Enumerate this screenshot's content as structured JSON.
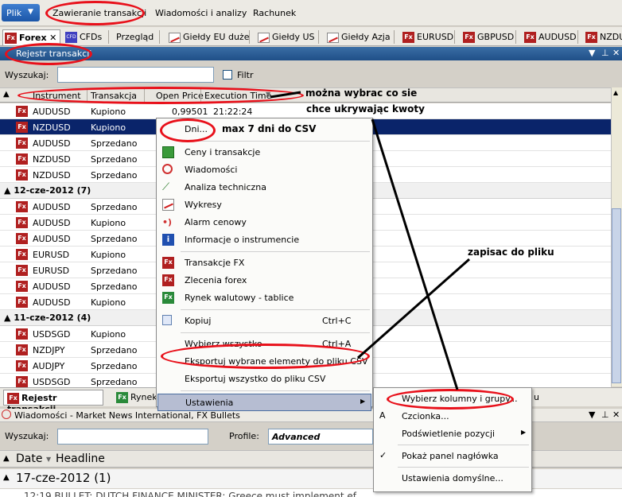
{
  "menubar": {
    "file_label": "Plik",
    "items": [
      "Zawieranie transakcji",
      "Wiadomości i analizy",
      "Rachunek"
    ]
  },
  "tabs": [
    {
      "label": "Forex",
      "icon": "fx-icon",
      "active": true
    },
    {
      "label": "CFDs",
      "icon": "cfd-icon"
    },
    {
      "label": "Przegląd"
    },
    {
      "label": "Giełdy EU duże",
      "icon": "chart-icon"
    },
    {
      "label": "Giełdy US",
      "icon": "chart-icon"
    },
    {
      "label": "Giełdy Azja",
      "icon": "chart-icon"
    },
    {
      "label": "EURUSD",
      "icon": "fx-icon"
    },
    {
      "label": "GBPUSD",
      "icon": "fx-icon"
    },
    {
      "label": "AUDUSD",
      "icon": "fx-icon"
    },
    {
      "label": "NZDU",
      "icon": "fx-icon"
    }
  ],
  "panel": {
    "title": "Rejestr transakcji",
    "search_label": "Wyszukaj:",
    "search_value": "",
    "filter_label": "Filtr"
  },
  "grid": {
    "columns": [
      "Instrument",
      "Transakcja",
      "Open Price",
      "Execution Time"
    ],
    "rows": [
      {
        "type": "row",
        "instrument": "AUDUSD",
        "transaction": "Kupiono",
        "price": "0,99501",
        "time": "21:22:24"
      },
      {
        "type": "row",
        "instrument": "NZDUSD",
        "transaction": "Kupiono",
        "price": "",
        "time": "",
        "selected": true
      },
      {
        "type": "row",
        "instrument": "AUDUSD",
        "transaction": "Sprzedano",
        "price": "",
        "time": ""
      },
      {
        "type": "row",
        "instrument": "NZDUSD",
        "transaction": "Sprzedano",
        "price": "",
        "time": ""
      },
      {
        "type": "row",
        "instrument": "NZDUSD",
        "transaction": "Sprzedano",
        "price": "",
        "time": ""
      },
      {
        "type": "group",
        "label": "12-cze-2012 (7)"
      },
      {
        "type": "row",
        "instrument": "AUDUSD",
        "transaction": "Sprzedano",
        "price": "",
        "time": ""
      },
      {
        "type": "row",
        "instrument": "AUDUSD",
        "transaction": "Kupiono",
        "price": "",
        "time": ""
      },
      {
        "type": "row",
        "instrument": "AUDUSD",
        "transaction": "Sprzedano",
        "price": "",
        "time": ""
      },
      {
        "type": "row",
        "instrument": "EURUSD",
        "transaction": "Kupiono",
        "price": "",
        "time": ""
      },
      {
        "type": "row",
        "instrument": "EURUSD",
        "transaction": "Sprzedano",
        "price": "",
        "time": ""
      },
      {
        "type": "row",
        "instrument": "AUDUSD",
        "transaction": "Sprzedano",
        "price": "",
        "time": ""
      },
      {
        "type": "row",
        "instrument": "AUDUSD",
        "transaction": "Kupiono",
        "price": "",
        "time": ""
      },
      {
        "type": "group",
        "label": "11-cze-2012 (4)"
      },
      {
        "type": "row",
        "instrument": "USDSGD",
        "transaction": "Kupiono",
        "price": "",
        "time": ""
      },
      {
        "type": "row",
        "instrument": "NZDJPY",
        "transaction": "Sprzedano",
        "price": "",
        "time": ""
      },
      {
        "type": "row",
        "instrument": "AUDJPY",
        "transaction": "Sprzedano",
        "price": "",
        "time": ""
      },
      {
        "type": "row",
        "instrument": "USDSGD",
        "transaction": "Sprzedano",
        "price": "",
        "time": ""
      }
    ]
  },
  "context_menu": {
    "items": [
      {
        "label": "Dni...",
        "icon": "",
        "shortcut": ""
      },
      {
        "sep": true
      },
      {
        "label": "Ceny i transakcje",
        "icon": "prices-icon",
        "shortcut": ""
      },
      {
        "label": "Wiadomości",
        "icon": "news-icon",
        "shortcut": ""
      },
      {
        "label": "Analiza techniczna",
        "icon": "analysis-icon",
        "shortcut": ""
      },
      {
        "label": "Wykresy",
        "icon": "chart-icon",
        "shortcut": ""
      },
      {
        "label": "Alarm cenowy",
        "icon": "alarm-icon",
        "shortcut": ""
      },
      {
        "label": "Informacje o instrumencie",
        "icon": "info-icon",
        "shortcut": ""
      },
      {
        "sep": true
      },
      {
        "label": "Transakcje FX",
        "icon": "fx-icon",
        "shortcut": ""
      },
      {
        "label": "Zlecenia forex",
        "icon": "fx-icon",
        "shortcut": ""
      },
      {
        "label": "Rynek walutowy - tablice",
        "icon": "fx-board-icon",
        "shortcut": ""
      },
      {
        "sep": true
      },
      {
        "label": "Kopiuj",
        "icon": "copy-icon",
        "shortcut": "Ctrl+C"
      },
      {
        "sep": true
      },
      {
        "label": "Wybierz wszystko",
        "icon": "",
        "shortcut": "Ctrl+A"
      },
      {
        "label": "Eksportuj wybrane elementy do pliku CSV",
        "icon": "",
        "shortcut": ""
      },
      {
        "label": "Eksportuj wszystko do pliku CSV",
        "icon": "",
        "shortcut": ""
      },
      {
        "sep": true
      },
      {
        "label": "Ustawienia",
        "icon": "",
        "shortcut": "",
        "submenu": true,
        "highlighted": true
      }
    ]
  },
  "submenu": {
    "items": [
      {
        "label": "Wybierz kolumny i grupy...",
        "icon": ""
      },
      {
        "label": "Czcionka...",
        "icon": "font-icon"
      },
      {
        "label": "Podświetlenie pozycji",
        "icon": "",
        "submenu": true
      },
      {
        "sep": true
      },
      {
        "label": "Pokaż panel nagłówka",
        "icon": "check-icon",
        "checked": true
      },
      {
        "sep": true
      },
      {
        "label": "Ustawienia domyślne...",
        "icon": ""
      }
    ]
  },
  "bottom_tabs": [
    {
      "label": "Rejestr transakcji",
      "icon": "fx-icon",
      "active": true
    },
    {
      "label": "Rynek",
      "icon": "fx-board-icon"
    },
    {
      "label": "u",
      "icon": ""
    }
  ],
  "news": {
    "title": "Wiadomości - Market News International, FX Bullets",
    "search_label": "Wyszukaj:",
    "profile_label": "Profile:",
    "profile_value": "Advanced",
    "columns": [
      "Date",
      "Headline"
    ],
    "group": "17-cze-2012 (1)",
    "row_text": "12:19  BULLET: DUTCH FINANCE MINISTER: Greece must implement ef"
  },
  "annotations": {
    "columns_note_1": "można wybrac co sie",
    "columns_note_2": "chce ukrywając kwoty",
    "days_note": "max 7 dni do CSV",
    "save_note": "zapisac do pliku"
  },
  "colors": {
    "highlight": "#0a246a",
    "annotation_red": "#e8101a",
    "panel_header": "#2a5d96"
  }
}
